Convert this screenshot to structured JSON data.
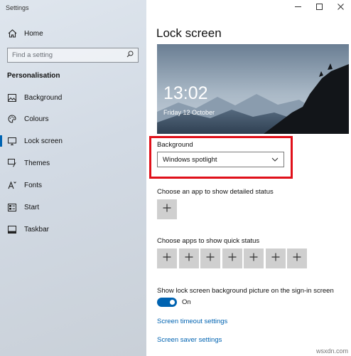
{
  "window": {
    "title": "Settings"
  },
  "sidebar": {
    "home_label": "Home",
    "search_placeholder": "Find a setting",
    "section_heading": "Personalisation",
    "items": [
      {
        "label": "Background",
        "icon": "picture-icon"
      },
      {
        "label": "Colours",
        "icon": "palette-icon"
      },
      {
        "label": "Lock screen",
        "icon": "monitor-icon",
        "active": true
      },
      {
        "label": "Themes",
        "icon": "brush-icon"
      },
      {
        "label": "Fonts",
        "icon": "font-icon"
      },
      {
        "label": "Start",
        "icon": "start-icon"
      },
      {
        "label": "Taskbar",
        "icon": "taskbar-icon"
      }
    ]
  },
  "main": {
    "page_title": "Lock screen",
    "preview": {
      "time": "13:02",
      "date": "Friday 12 October"
    },
    "background_label": "Background",
    "background_value": "Windows spotlight",
    "detailed_status_label": "Choose an app to show detailed status",
    "quick_status_label": "Choose apps to show quick status",
    "quick_status_count": 7,
    "signin_label": "Show lock screen background picture on the sign-in screen",
    "signin_state": "On",
    "links": {
      "timeout": "Screen timeout settings",
      "saver": "Screen saver settings"
    }
  },
  "accent_color": "#0063b1",
  "highlight_color": "#e0101a",
  "watermark": "wsxdn.com"
}
